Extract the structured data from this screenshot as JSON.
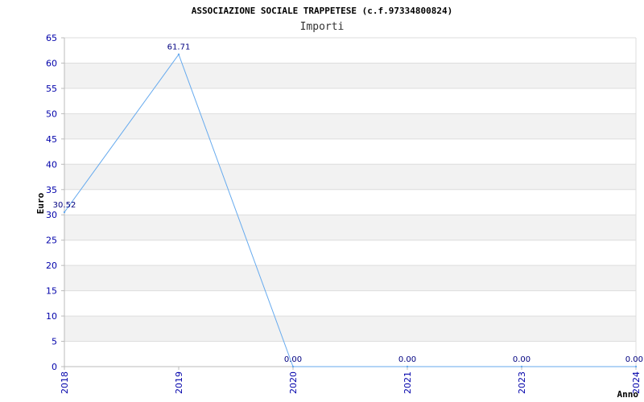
{
  "chart_data": {
    "type": "line",
    "title": "ASSOCIAZIONE SOCIALE TRAPPETESE (c.f.97334800824)",
    "subtitle": "Importi",
    "xlabel": "Anno",
    "ylabel": "Euro",
    "categories": [
      "2018",
      "2019",
      "2020",
      "2021",
      "2023",
      "2024"
    ],
    "series": [
      {
        "values": [
          30.52,
          61.71,
          0.0,
          0.0,
          0.0,
          0.0
        ],
        "labels": [
          "30.52",
          "61.71",
          "0.00",
          "0.00",
          "0.00",
          "0.00"
        ]
      }
    ],
    "ylim": [
      0,
      65
    ],
    "yticks": [
      0,
      5,
      10,
      15,
      20,
      25,
      30,
      35,
      40,
      45,
      50,
      55,
      60,
      65
    ],
    "grid": "horizontal alternating bands",
    "colors": {
      "line": "#66aaee",
      "band": "#f2f2f2",
      "tick_text": "#0000aa",
      "data_label": "#000080"
    }
  }
}
